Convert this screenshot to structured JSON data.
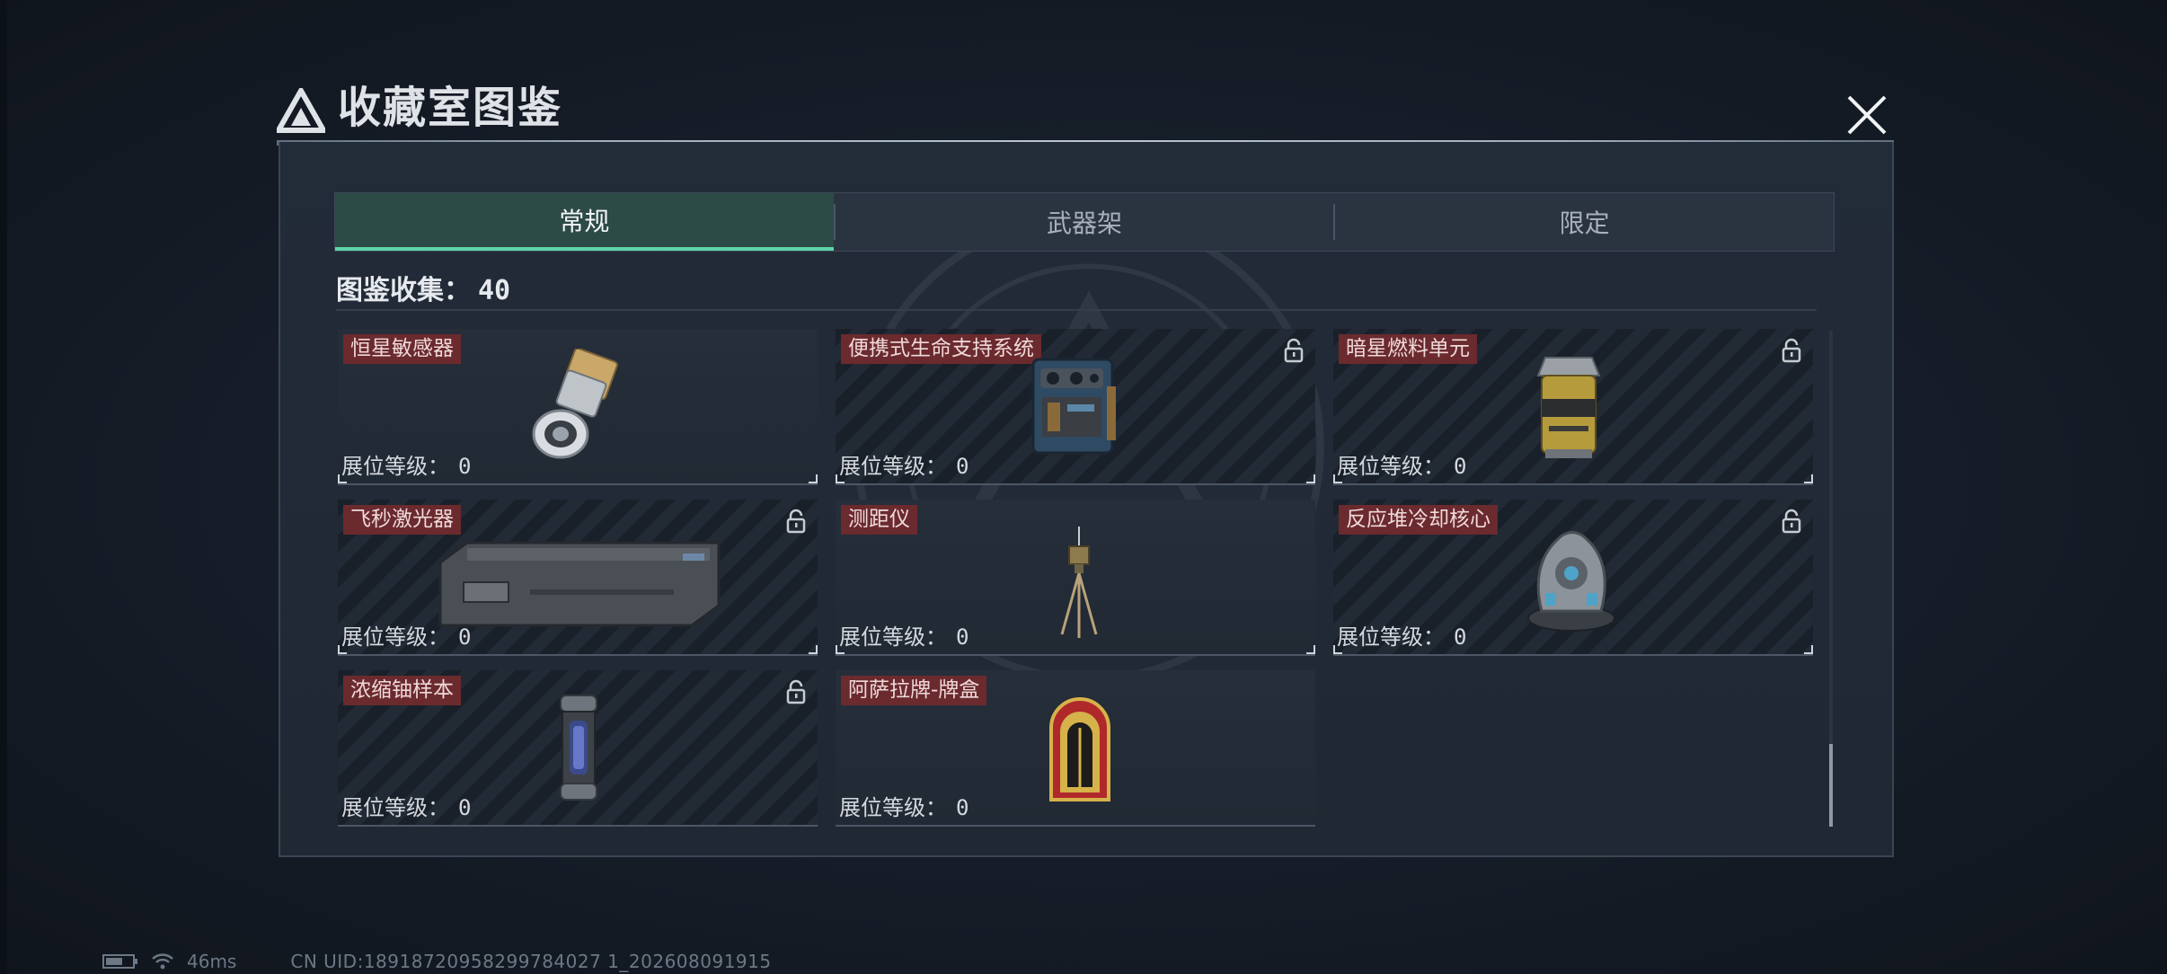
{
  "window": {
    "title": "收藏室图鉴",
    "close_label": "close"
  },
  "tabs": [
    {
      "label": "常规",
      "active": true
    },
    {
      "label": "武器架",
      "active": false
    },
    {
      "label": "限定",
      "active": false
    }
  ],
  "collection": {
    "label": "图鉴收集：",
    "count": "40"
  },
  "items": [
    {
      "name": "恒星敏感器",
      "level_label": "展位等级：",
      "level": "0",
      "locked": false,
      "art": "sensor"
    },
    {
      "name": "便携式生命支持系统",
      "level_label": "展位等级：",
      "level": "0",
      "locked": true,
      "art": "life-support"
    },
    {
      "name": "暗星燃料单元",
      "level_label": "展位等级：",
      "level": "0",
      "locked": true,
      "art": "fuel-cell"
    },
    {
      "name": "飞秒激光器",
      "level_label": "展位等级：",
      "level": "0",
      "locked": true,
      "art": "laser"
    },
    {
      "name": "测距仪",
      "level_label": "展位等级：",
      "level": "0",
      "locked": false,
      "art": "rangefinder"
    },
    {
      "name": "反应堆冷却核心",
      "level_label": "展位等级：",
      "level": "0",
      "locked": true,
      "art": "reactor-core"
    },
    {
      "name": "浓缩铀样本",
      "level_label": "展位等级：",
      "level": "0",
      "locked": true,
      "art": "uranium"
    },
    {
      "name": "阿萨拉牌-牌盒",
      "level_label": "展位等级：",
      "level": "0",
      "locked": false,
      "art": "card-box"
    }
  ],
  "status_bar": {
    "ping": "46ms",
    "uid": "CN UID:18918720958299784027 1_202608091915"
  },
  "colors": {
    "accent": "#5fd3a6",
    "tag_bg": "#6a2a2e",
    "panel_bg": "#222b38"
  }
}
